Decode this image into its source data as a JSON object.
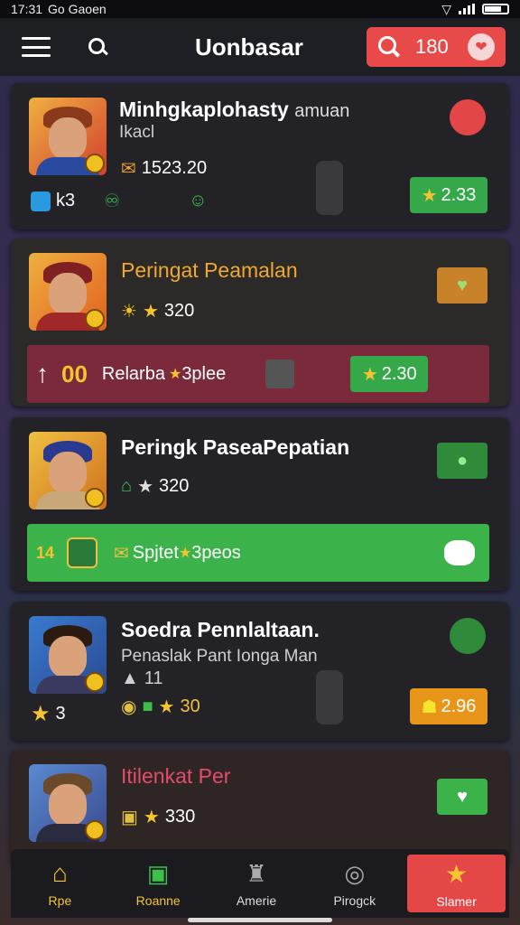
{
  "status_bar": {
    "time": "17:31",
    "carrier": "Go Gaoen"
  },
  "header": {
    "title": "Uonbasar",
    "coin_count": "180",
    "menu_icon": "hamburger-icon",
    "search_icon": "search-icon"
  },
  "cards": [
    {
      "title": "Minhgkaplohasty",
      "title_suffix": "amuan",
      "subtitle": "Ikacl",
      "score": "1523.20",
      "footer_text": "k3",
      "rating": "2.33",
      "accent": "#e24646"
    },
    {
      "title": "Peringat Peamalan",
      "stat": "320",
      "bar_number": "00",
      "bar_text": "Relarba",
      "bar_text2": "3plee",
      "rating": "2.30",
      "accent": "#e39a2a"
    },
    {
      "title": "Peringk PaseaPepatian",
      "stat": "320",
      "bar_badge": "14",
      "bar_text": "Spjtet",
      "bar_text2": "3peos",
      "accent": "#3cb34a"
    },
    {
      "title": "Soedra Pennlaltaan.",
      "subtitle": "Penaslak Pant Ionga Man",
      "count": "11",
      "footer_text": "3",
      "stat": "30",
      "rating": "2.96"
    },
    {
      "title": "Itilenkat Per",
      "stat": "330"
    }
  ],
  "tabs": [
    {
      "label": "Rpe",
      "icon": "home-icon"
    },
    {
      "label": "Roanne",
      "icon": "gamepad-icon"
    },
    {
      "label": "Amerie",
      "icon": "castle-icon"
    },
    {
      "label": "Pirogck",
      "icon": "target-icon"
    },
    {
      "label": "Slamer",
      "icon": "star-icon"
    }
  ],
  "colors": {
    "header_bg": "#1e1f24",
    "coin_button": "#e84a4a",
    "green": "#3cb34a",
    "orange": "#e39a2a",
    "red": "#e24646"
  }
}
